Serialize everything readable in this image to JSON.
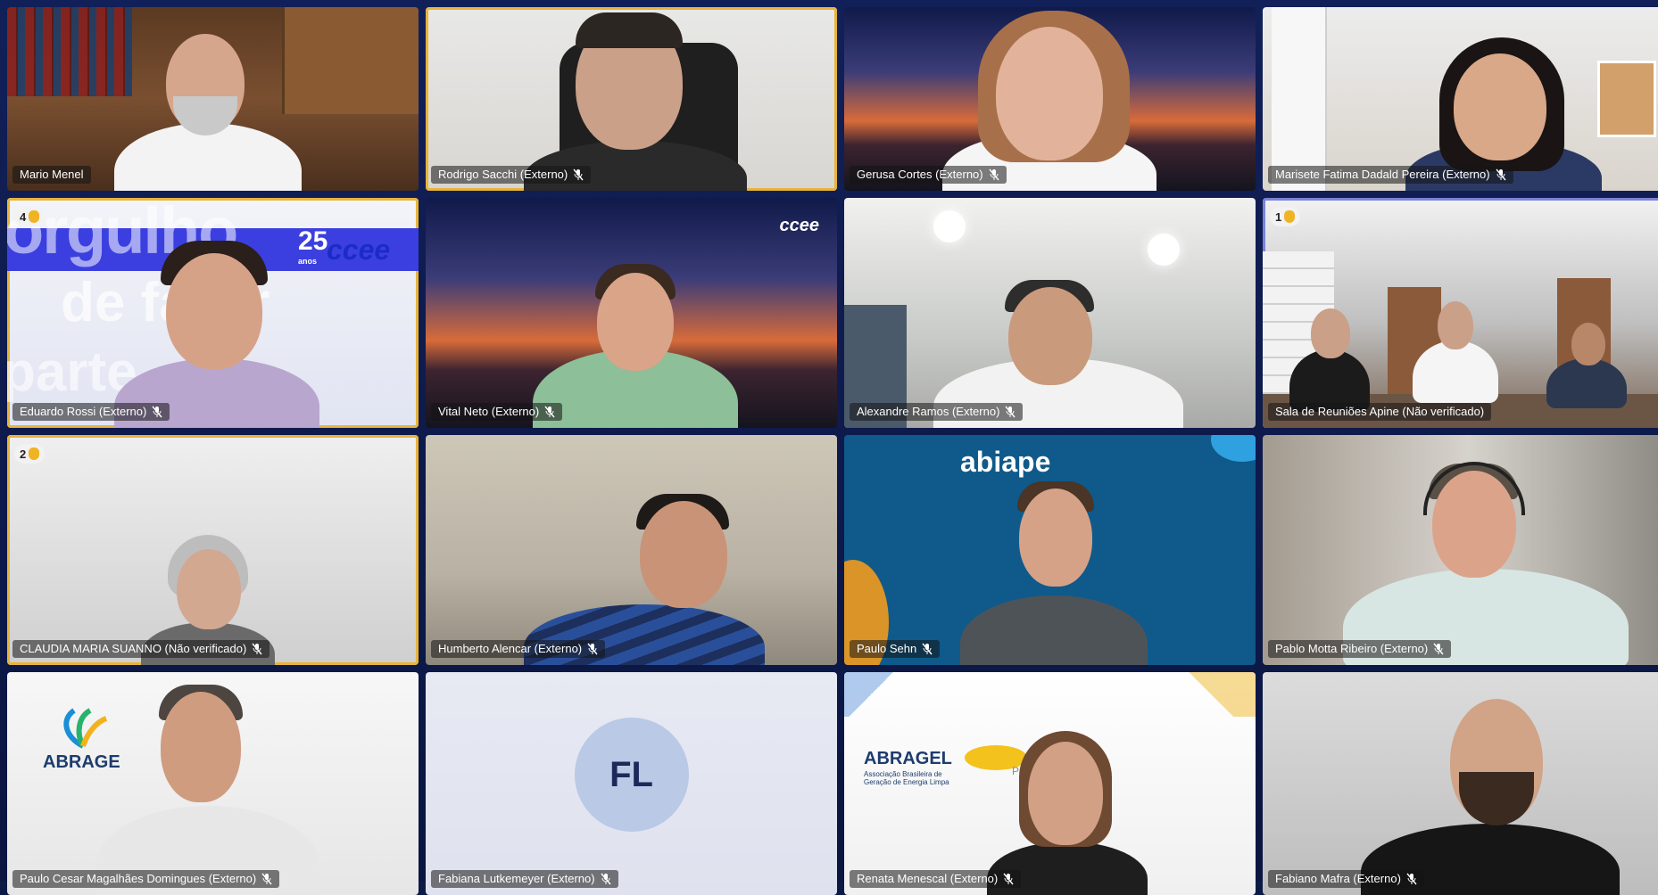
{
  "participants": [
    {
      "name": "Mario Menel"
    },
    {
      "name": "Rodrigo Sacchi (Externo)"
    },
    {
      "name": "Gerusa Cortes (Externo)"
    },
    {
      "name": "Marisete Fatima Dadald Pereira (Externo)"
    },
    {
      "name": "Eduardo Rossi (Externo)",
      "hand": "4"
    },
    {
      "name": "Vital Neto (Externo)"
    },
    {
      "name": "Alexandre Ramos (Externo)"
    },
    {
      "name": "Sala de Reuniões Apine (Não verificado)",
      "hand": "1"
    },
    {
      "name": "CLAUDIA MARIA SUANNO (Não verificado)",
      "hand": "2"
    },
    {
      "name": "Humberto Alencar (Externo)"
    },
    {
      "name": "Paulo Sehn"
    },
    {
      "name": "Pablo Motta Ribeiro (Externo)"
    },
    {
      "name": "Paulo Cesar Magalhães Domingues (Externo)"
    },
    {
      "name": "Fabiana Lutkemeyer (Externo)",
      "initials": "FL"
    },
    {
      "name": "Renata Menescal (Externo)"
    },
    {
      "name": "Fabiano Mafra (Externo)"
    }
  ],
  "logos": {
    "ccee_banner_word_1": "orgulho",
    "ccee_banner_word_2": "de fazer",
    "ccee_banner_word_3": "parte",
    "ccee_years": "25",
    "ccee_years_label": "anos",
    "ccee": "ccee",
    "ccee_small": "ccee",
    "abiape": "abiape",
    "abrage": "ABRAGE",
    "abragel": "ABRAGEL",
    "abragel_sub": "Associação Brasileira de Geração de Energia Limpa",
    "abragel_pch": "PCH"
  },
  "colors": {
    "highlight_yellow": "#e8b43a",
    "highlight_blue": "#7b82d6",
    "ccee_blue": "#2a3bd1",
    "abiape_blue": "#0f5a8a"
  },
  "icons": {
    "mic_off": "mic-off-icon",
    "raised_hand": "hand-icon"
  }
}
